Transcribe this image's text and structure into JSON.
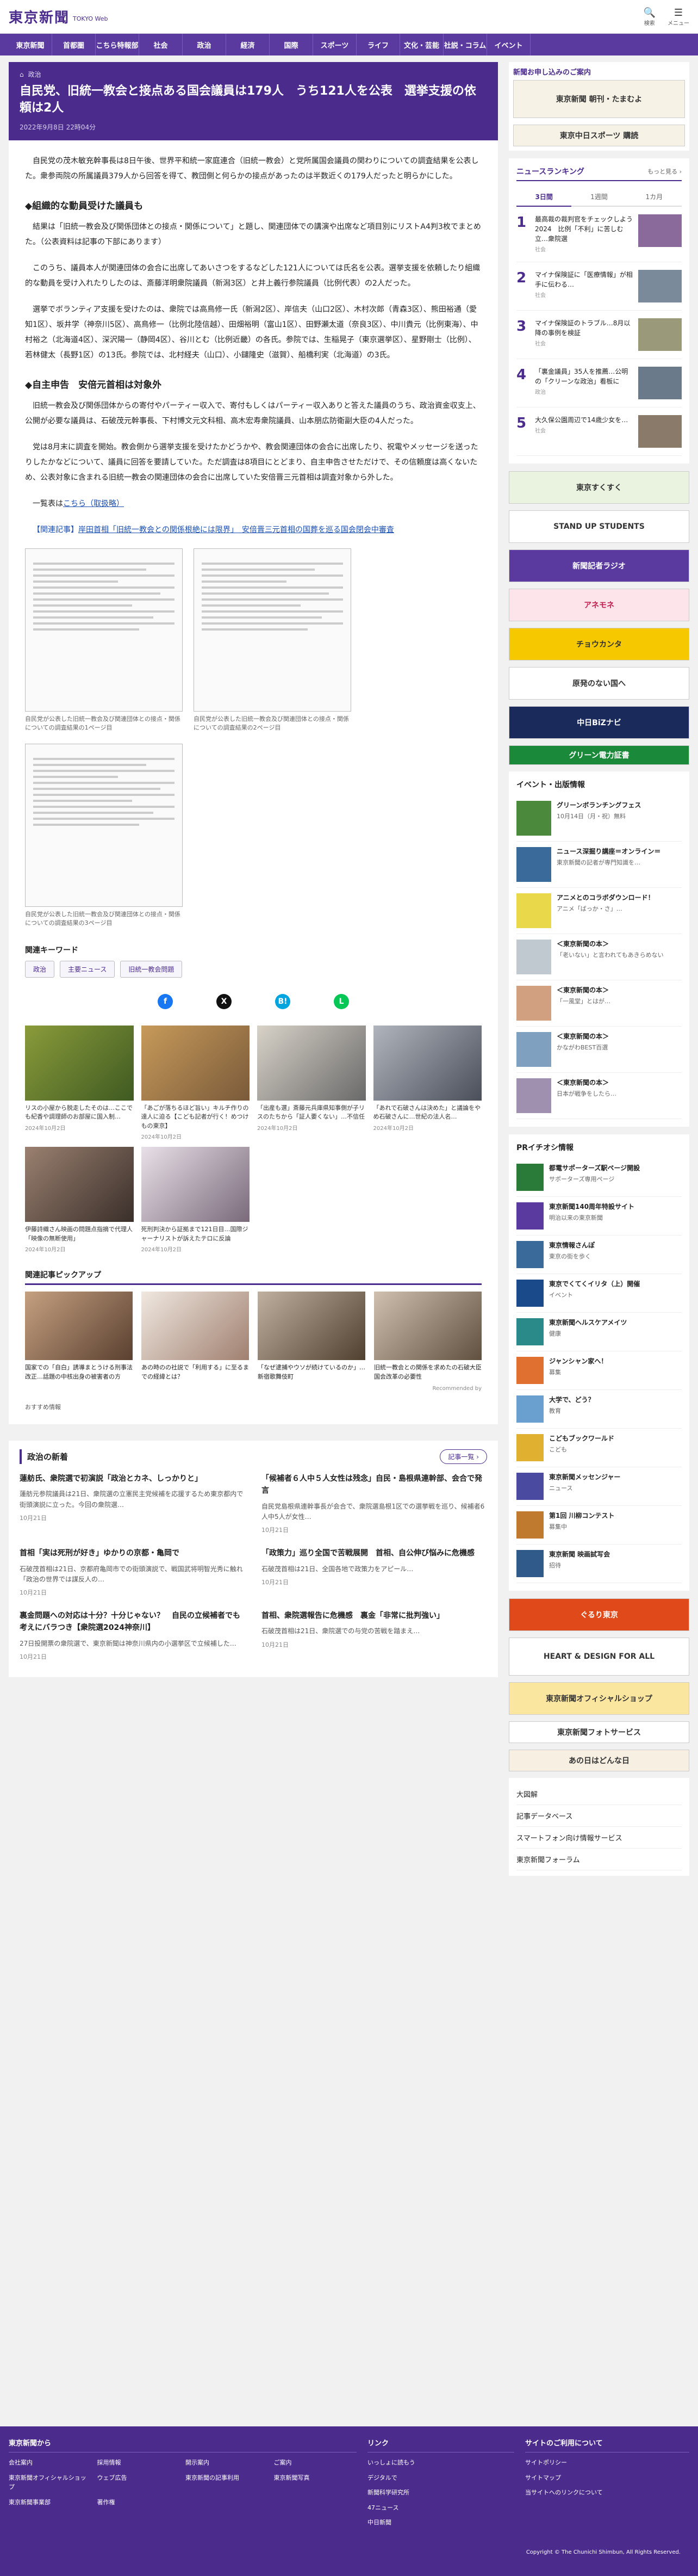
{
  "header": {
    "logo": "東京新聞",
    "logo_sub": "TOKYO Web",
    "icons": [
      {
        "name": "search-icon",
        "glyph": "🔍",
        "label": "検索"
      },
      {
        "name": "menu-icon",
        "glyph": "☰",
        "label": "メニュー"
      }
    ]
  },
  "nav": {
    "items": [
      "東京新聞",
      "首都圏",
      "こちら特報部",
      "社会",
      "政治",
      "経済",
      "国際",
      "スポーツ",
      "ライフ",
      "文化・芸能",
      "社説・コラム",
      "イベント"
    ]
  },
  "article": {
    "breadcrumb_home": "⌂",
    "breadcrumb_section": "政治",
    "headline": "自民党、旧統一教会と接点ある国会議員は179人　うち121人を公表　選挙支援の依頼は2人",
    "pubdate": "2022年9月8日 22時04分",
    "paragraphs": [
      "自民党の茂木敏充幹事長は8日午後、世界平和統一家庭連合（旧統一教会）と党所属国会議員の関わりについての調査結果を公表した。衆参両院の所属議員379人から回答を得て、教団側と何らかの接点があったのは半数近くの179人だったと明らかにした。"
    ],
    "h2_1": "◆組織的な動員受けた議員も",
    "paragraphs2": [
      "結果は「旧統一教会及び関係団体との接点・関係について」と題し、関連団体での講演や出席など項目別にリストA4判3枚でまとめた。（公表資料は記事の下部にあります）",
      "このうち、議員本人が関連団体の会合に出席してあいさつをするなどした121人については氏名を公表。選挙支援を依頼したり組織的な動員を受け入れたりしたのは、斎藤洋明衆院議員（新潟3区）と井上義行参院議員（比例代表）の2人だった。",
      "選挙でボランティア支援を受けたのは、衆院では高鳥修一氏（新潟2区）、岸信夫（山口2区）、木村次郎（青森3区）、熊田裕通（愛知1区）、坂井学（神奈川5区）、高鳥修一（比例北陸信越）、田畑裕明（富山1区）、田野瀬太道（奈良3区）、中川貴元（比例東海）、中村裕之（北海道4区）、深沢陽一（静岡4区）、谷川とむ（比例近畿）の各氏。参院では、生稲晃子（東京選挙区）、星野剛士（比例）、若林健太（長野1区）の13氏。参院では、北村経夫（山口）、小鑓隆史（滋賀）、船橋利実（北海道）の3氏。"
    ],
    "h2_2": "◆自主申告　安倍元首相は対象外",
    "paragraphs3": [
      "旧統一教会及び関係団体からの寄付やパーティー収入で、寄付もしくはパーティー収入ありと答えた議員のうち、政治資金収支上、公開が必要な議員は、石破茂元幹事長、下村博文元文科相、高木宏寿衆院議員、山本朋広防衛副大臣の4人だった。",
      "党は8月末に調査を開始。教会側から選挙支援を受けたかどうかや、教会関連団体の会合に出席したり、祝電やメッセージを送ったりしたかなどについて、議員に回答を要請していた。ただ調査は8項目にとどまり、自主申告させただけで、その信頼度は高くないため、公表対象に含まれる旧統一教会の関連団体の会合に出席していた安倍晋三元首相は調査対象から外した。"
    ],
    "list_link_prefix": "一覧表は",
    "list_link": "こちら（取扱略）",
    "related_prefix": "【関連記事】",
    "related_link": "岸田首相「旧統一教会との関係根絶には限界」　安倍晋三元首相の国葬を巡る国会閉会中審査",
    "docs": [
      {
        "caption": "自民党が公表した旧統一教会及び関連団体との接点・関係についての調査結果の1ページ目"
      },
      {
        "caption": "自民党が公表した旧統一教会及び関連団体との接点・関係についての調査結果の2ページ目"
      },
      {
        "caption": "自民党が公表した旧統一教会及び関連団体との接点・関係についての調査結果の3ページ目"
      }
    ],
    "kw_title": "関連キーワード",
    "keywords": [
      "政治",
      "主要ニュース",
      "旧統一教会問題"
    ]
  },
  "share": [
    {
      "name": "facebook-share-icon",
      "glyph": "f",
      "color": "#1877f2"
    },
    {
      "name": "x-share-icon",
      "glyph": "X",
      "color": "#111111"
    },
    {
      "name": "hatena-share-icon",
      "glyph": "B!",
      "color": "#00a4de"
    },
    {
      "name": "line-share-icon",
      "glyph": "L",
      "color": "#06c755"
    }
  ],
  "thumbs": [
    {
      "title": "リスの小屋から脱走したそのは…ここでも紀香や調理師のお部屋に国入制…",
      "date": "2024年10月2日"
    },
    {
      "title": "「あごが落ちるほど旨い」キルチ作りの達人に迫る【こども記者が行く！めつけもの東京】",
      "date": "2024年10月2日"
    },
    {
      "title": "「出産も選」斎藤元兵庫県知事側が子リスのたちから「証人要くない」…不信任",
      "date": "2024年10月2日"
    },
    {
      "title": "「あれで石破さんは決めた」と議論をやめ石破さんに…世紀の法人名…",
      "date": "2024年10月2日"
    },
    {
      "title": "伊藤詩織さん映画の問題点指摘で代理人「映像の無断使用」",
      "date": "2024年10月2日"
    },
    {
      "title": "死刑判決から証拠まで121日目…国際ジャーナリストが訴えたテロに反論",
      "date": "2024年10月2日"
    }
  ],
  "pickup_title": "関連記事ピックアップ",
  "pickup": [
    {
      "title": "国家での「自白」誘導まとうける刑事法改正…話題の中核出身の被害者の方",
      "date": ""
    },
    {
      "title": "あの時のの社説で「利用する」に至るまでの経緯とは？",
      "date": ""
    },
    {
      "title": "「なぜ逮捕やウソが続けているのか」…新宿歌舞伎町",
      "date": ""
    },
    {
      "title": "旧統一教会との関係を求めたの石破大臣　国会改革の必要性",
      "date": ""
    }
  ],
  "recommended_label": "Recommended by",
  "osusume_label": "おすすめ情報",
  "politics": {
    "title": "政治の新着",
    "more": "記事一覧 ›",
    "items": [
      {
        "h": "蓮舫氏、衆院選で初演説「政治とカネ、しっかりと」",
        "s": "蓮舫元参院議員は21日、衆院選の立憲民主党候補を応援するため東京都内で街頭演説に立った。今回の衆院選…",
        "d": "10月21日"
      },
      {
        "h": "「候補者６人中５人女性は残念」自民・島根県連幹部、会合で発言",
        "s": "自民党島根県連幹事長が会合で、衆院選島根1区での選挙戦を巡り、候補者6人中5人が女性…",
        "d": "10月21日"
      },
      {
        "h": "首相「実は死刑が好き」ゆかりの京都・亀岡で",
        "s": "石破茂首相は21日、京都府亀岡市での街頭演説で、戦国武将明智光秀に触れ「政治の世界では謀反人の…",
        "d": "10月21日"
      },
      {
        "h": "「政策力」巡り全国で苦戦展開　首相、自公伸び悩みに危機感",
        "s": "石破茂首相は21日、全国各地で政策力をアピール…",
        "d": "10月21日"
      },
      {
        "h": "裏金問題への対応は十分？十分じゃない？　自民の立候補者でも考えにバラつき【衆院選2024神奈川】",
        "s": "27日投開票の衆院選で、東京新聞は神奈川県内の小選挙区で立候補した…",
        "d": "10月21日"
      },
      {
        "h": "首相、衆院選報告に危機感　裏金「非常に批判強い」",
        "s": "石破茂首相は21日、衆院選での与党の苦戦を踏まえ…",
        "d": "10月21日"
      }
    ]
  },
  "side": {
    "subscribe_title": "新聞お申し込みのご案内",
    "ads_top": [
      "東京新聞 朝刊・たまむよ",
      "東京中日スポーツ 購読"
    ],
    "ranking": {
      "title": "ニュースランキング",
      "more": "もっと見る ›",
      "tabs": [
        "3日間",
        "1週間",
        "1カ月"
      ],
      "items": [
        {
          "rank": "1",
          "t": "最高裁の裁判官をチェックしよう2024　比例「不利」に苦しむ立…衆院選",
          "c": "社会"
        },
        {
          "rank": "2",
          "t": "マイナ保険証に「医療情報」が相手に伝わる…",
          "c": "社会"
        },
        {
          "rank": "3",
          "t": "マイナ保険証のトラブル…8月以降の事例を検証",
          "c": "社会"
        },
        {
          "rank": "4",
          "t": "「裏金議員」35人を推薦…公明の「クリーンな政治」看板に",
          "c": "政治"
        },
        {
          "rank": "5",
          "t": "大久保公園周辺で14歳少女を…",
          "c": "社会"
        }
      ]
    },
    "ads": [
      "東京すくすく",
      "STAND UP STUDENTS",
      "新聞記者ラジオ",
      "アネモネ",
      "チョウカンタ",
      "原発のない国へ",
      "中日BiZナビ",
      "グリーン電力証書"
    ],
    "events_title": "イベント・出版情報",
    "events": [
      {
        "t": "グリーンボランチングフェス",
        "s": "10月14日（月・祝）無料"
      },
      {
        "t": "ニュース深掘り講座＝オンライン＝",
        "s": "東京新聞の記者が専門知識を…"
      },
      {
        "t": "アニメとのコラボダウンロード！",
        "s": "アニメ「ばっか・さ」…"
      },
      {
        "t": "＜東京新聞の本＞",
        "s": "「老いない」と言われてもあきらめない"
      },
      {
        "t": "＜東京新聞の本＞",
        "s": "「一風堂」とはが…"
      },
      {
        "t": "＜東京新聞の本＞",
        "s": "かながわBEST百選"
      },
      {
        "t": "＜東京新聞の本＞",
        "s": "日本が戦争をしたら…"
      }
    ],
    "pr_title": "PRイチオシ情報",
    "pr": [
      {
        "t": "都電サポーターズ駅ページ開設",
        "s": "サポーターズ専用ページ"
      },
      {
        "t": "東京新聞140周年特設サイト",
        "s": "明治以来の東京新聞"
      },
      {
        "t": "東京情報さんぽ",
        "s": "東京の街を歩く"
      },
      {
        "t": "東京でくてくイリタ（上）開催",
        "s": "イベント"
      },
      {
        "t": "東京新聞ヘルスケアメイツ",
        "s": "健康"
      },
      {
        "t": "ジャンシャン家へ！",
        "s": "募集"
      },
      {
        "t": "大学で、どう？",
        "s": "教育"
      },
      {
        "t": "こどもブックワールド",
        "s": "こども"
      },
      {
        "t": "東京新聞メッセンジャー",
        "s": "ニュース"
      },
      {
        "t": "第1回 川柳コンテスト",
        "s": "募集中"
      },
      {
        "t": "東京新聞 映画試写会",
        "s": "招待"
      }
    ],
    "banners_bottom": [
      "ぐるり東京",
      "HEART & DESIGN FOR ALL",
      "東京新聞オフィシャルショップ",
      "東京新聞フォトサービス",
      "あの日はどんな日"
    ],
    "links": [
      "大図解",
      "記事データベース",
      "スマートフォン向け情報サービス",
      "東京新聞フォーラム"
    ]
  },
  "footer": {
    "col1_title": "東京新聞から",
    "col1_links": [
      "会社案内",
      "採用情報",
      "開示案内",
      "ご案内",
      "東京新聞オフィシャルショップ",
      "ウェブ広告",
      "東京新聞の記事利用",
      "東京新聞写真",
      "東京新聞事業部",
      "著作権"
    ],
    "col2_title": "リンク",
    "col2_links": [
      "いっしょに読もう",
      "デジタルで",
      "新聞科学研究所",
      "47ニュース",
      "中日新聞"
    ],
    "col3_title": "サイトのご利用について",
    "col3_links": [
      "サイトポリシー",
      "サイトマップ",
      "当サイトへのリンクについて"
    ],
    "copyright": "Copyright © The Chunichi Shimbun, All Rights Reserved."
  }
}
